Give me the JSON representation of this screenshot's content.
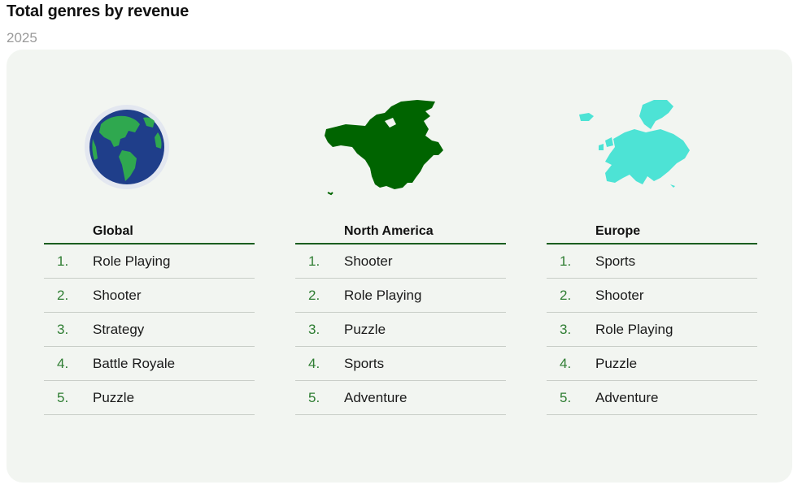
{
  "title": "Total genres by revenue",
  "subtitle": "2025",
  "colors": {
    "accent": "#1b5e20",
    "panel": "#f2f5f1",
    "north_america": "#006400",
    "europe": "#4de3d5",
    "globe_ocean": "#1f3e8a",
    "globe_land": "#2fa84f"
  },
  "regions": [
    {
      "name": "Global",
      "icon": "globe-icon",
      "rows": [
        {
          "rank": "1.",
          "genre": "Role Playing"
        },
        {
          "rank": "2.",
          "genre": "Shooter"
        },
        {
          "rank": "3.",
          "genre": "Strategy"
        },
        {
          "rank": "4.",
          "genre": "Battle Royale"
        },
        {
          "rank": "5.",
          "genre": "Puzzle"
        }
      ]
    },
    {
      "name": "North America",
      "icon": "north-america-map-icon",
      "rows": [
        {
          "rank": "1.",
          "genre": "Shooter"
        },
        {
          "rank": "2.",
          "genre": "Role Playing"
        },
        {
          "rank": "3.",
          "genre": "Puzzle"
        },
        {
          "rank": "4.",
          "genre": "Sports"
        },
        {
          "rank": "5.",
          "genre": "Adventure"
        }
      ]
    },
    {
      "name": "Europe",
      "icon": "europe-map-icon",
      "rows": [
        {
          "rank": "1.",
          "genre": "Sports"
        },
        {
          "rank": "2.",
          "genre": "Shooter"
        },
        {
          "rank": "3.",
          "genre": "Role Playing"
        },
        {
          "rank": "4.",
          "genre": "Puzzle"
        },
        {
          "rank": "5.",
          "genre": "Adventure"
        }
      ]
    }
  ]
}
